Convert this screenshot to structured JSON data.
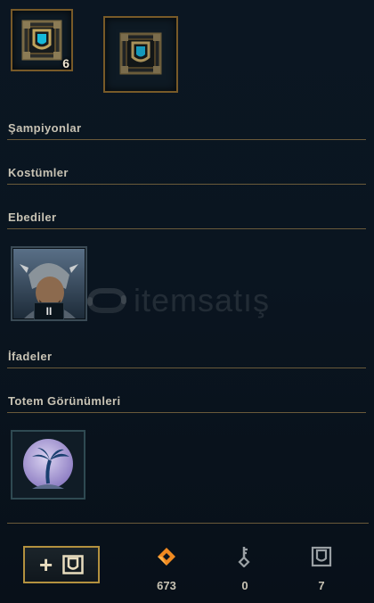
{
  "loot_row": {
    "chest_count": "6"
  },
  "sections": {
    "champions": "Şampiyonlar",
    "skins": "Kostümler",
    "eternals": "Ebediler",
    "emotes": "İfadeler",
    "ward_skins": "Totem Görünümleri"
  },
  "eternals": {
    "card_rank": "II"
  },
  "watermark": {
    "text": "itemsatış"
  },
  "footer": {
    "add_button_symbol": "+",
    "orange_essence": "673",
    "keys": "0",
    "chests": "7"
  },
  "colors": {
    "gold_border": "#785a28",
    "orange_essence": "#f08a21",
    "hextech_blue": "#1fb6d6"
  }
}
